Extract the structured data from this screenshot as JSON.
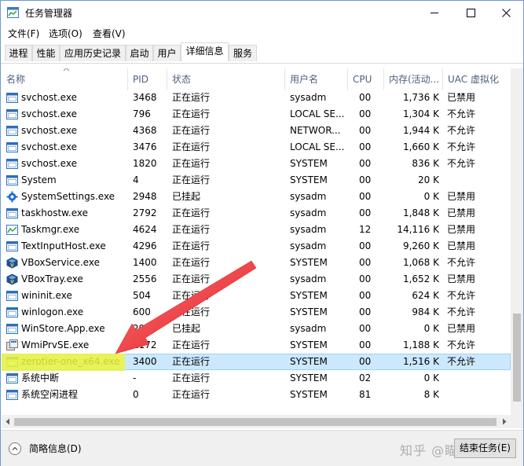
{
  "window": {
    "title": "任务管理器"
  },
  "menu": [
    {
      "label": "文件(F)"
    },
    {
      "label": "选项(O)"
    },
    {
      "label": "查看(V)"
    }
  ],
  "tabs": [
    {
      "label": "进程"
    },
    {
      "label": "性能"
    },
    {
      "label": "应用历史记录"
    },
    {
      "label": "启动"
    },
    {
      "label": "用户"
    },
    {
      "label": "详细信息",
      "active": true
    },
    {
      "label": "服务"
    }
  ],
  "columns": [
    {
      "label": "名称"
    },
    {
      "label": "PID"
    },
    {
      "label": "状态"
    },
    {
      "label": "用户名"
    },
    {
      "label": "CPU"
    },
    {
      "label": "内存(活动..."
    },
    {
      "label": "UAC 虚拟化"
    }
  ],
  "rows": [
    {
      "name": "svchost.exe",
      "pid": "3468",
      "status": "正在运行",
      "user": "sysadm",
      "cpu": "00",
      "mem": "1,736 K",
      "uac": "已禁用",
      "icon": "service-icon"
    },
    {
      "name": "svchost.exe",
      "pid": "796",
      "status": "正在运行",
      "user": "LOCAL SE...",
      "cpu": "00",
      "mem": "1,304 K",
      "uac": "不允许",
      "icon": "service-icon"
    },
    {
      "name": "svchost.exe",
      "pid": "4368",
      "status": "正在运行",
      "user": "NETWOR...",
      "cpu": "00",
      "mem": "1,944 K",
      "uac": "不允许",
      "icon": "service-icon"
    },
    {
      "name": "svchost.exe",
      "pid": "3476",
      "status": "正在运行",
      "user": "LOCAL SE...",
      "cpu": "00",
      "mem": "1,660 K",
      "uac": "不允许",
      "icon": "service-icon"
    },
    {
      "name": "svchost.exe",
      "pid": "1820",
      "status": "正在运行",
      "user": "SYSTEM",
      "cpu": "00",
      "mem": "836 K",
      "uac": "不允许",
      "icon": "service-icon"
    },
    {
      "name": "System",
      "pid": "4",
      "status": "正在运行",
      "user": "SYSTEM",
      "cpu": "00",
      "mem": "20 K",
      "uac": "",
      "icon": "service-icon"
    },
    {
      "name": "SystemSettings.exe",
      "pid": "2948",
      "status": "已挂起",
      "user": "sysadm",
      "cpu": "00",
      "mem": "0 K",
      "uac": "已禁用",
      "icon": "settings-gear-icon"
    },
    {
      "name": "taskhostw.exe",
      "pid": "2792",
      "status": "正在运行",
      "user": "sysadm",
      "cpu": "00",
      "mem": "1,848 K",
      "uac": "已禁用",
      "icon": "service-icon"
    },
    {
      "name": "Taskmgr.exe",
      "pid": "4624",
      "status": "正在运行",
      "user": "sysadm",
      "cpu": "12",
      "mem": "14,116 K",
      "uac": "已禁用",
      "icon": "taskmgr-icon"
    },
    {
      "name": "TextInputHost.exe",
      "pid": "4296",
      "status": "正在运行",
      "user": "sysadm",
      "cpu": "00",
      "mem": "9,260 K",
      "uac": "已禁用",
      "icon": "service-icon"
    },
    {
      "name": "VBoxService.exe",
      "pid": "1400",
      "status": "正在运行",
      "user": "SYSTEM",
      "cpu": "00",
      "mem": "1,068 K",
      "uac": "不允许",
      "icon": "vbox-icon"
    },
    {
      "name": "VBoxTray.exe",
      "pid": "2556",
      "status": "正在运行",
      "user": "sysadm",
      "cpu": "00",
      "mem": "1,652 K",
      "uac": "已禁用",
      "icon": "vbox-tray-icon"
    },
    {
      "name": "wininit.exe",
      "pid": "504",
      "status": "正在运行",
      "user": "SYSTEM",
      "cpu": "00",
      "mem": "624 K",
      "uac": "不允许",
      "icon": "service-icon"
    },
    {
      "name": "winlogon.exe",
      "pid": "600",
      "status": "正在运行",
      "user": "SYSTEM",
      "cpu": "00",
      "mem": "984 K",
      "uac": "不允许",
      "icon": "service-icon"
    },
    {
      "name": "WinStore.App.exe",
      "pid": "298",
      "status": "已挂起",
      "user": "sysadm",
      "cpu": "00",
      "mem": "0 K",
      "uac": "已禁用",
      "icon": "service-icon"
    },
    {
      "name": "WmiPrvSE.exe",
      "pid": "1172",
      "status": "正在运行",
      "user": "SYSTEM",
      "cpu": "00",
      "mem": "1,188 K",
      "uac": "不允许",
      "icon": "wmi-icon"
    },
    {
      "name": "zerotier-one_x64.exe",
      "pid": "3400",
      "status": "正在运行",
      "user": "SYSTEM",
      "cpu": "00",
      "mem": "1,516 K",
      "uac": "不允许",
      "icon": "service-icon",
      "selected": true
    },
    {
      "name": "系统中断",
      "pid": "-",
      "status": "正在运行",
      "user": "SYSTEM",
      "cpu": "02",
      "mem": "0 K",
      "uac": "",
      "icon": "service-icon"
    },
    {
      "name": "系统空闲进程",
      "pid": "0",
      "status": "正在运行",
      "user": "SYSTEM",
      "cpu": "81",
      "mem": "8 K",
      "uac": "",
      "icon": "service-icon"
    }
  ],
  "footer": {
    "fewer_details": "简略信息(D)",
    "end_task": "结束任务(E)",
    "watermark": "知乎 @瞄瞄小鹏"
  },
  "colors": {
    "selected_row": "#cce8ff",
    "highlight": "#ebf53c",
    "arrow": "#e8191f",
    "header_text": "#4d6082"
  }
}
